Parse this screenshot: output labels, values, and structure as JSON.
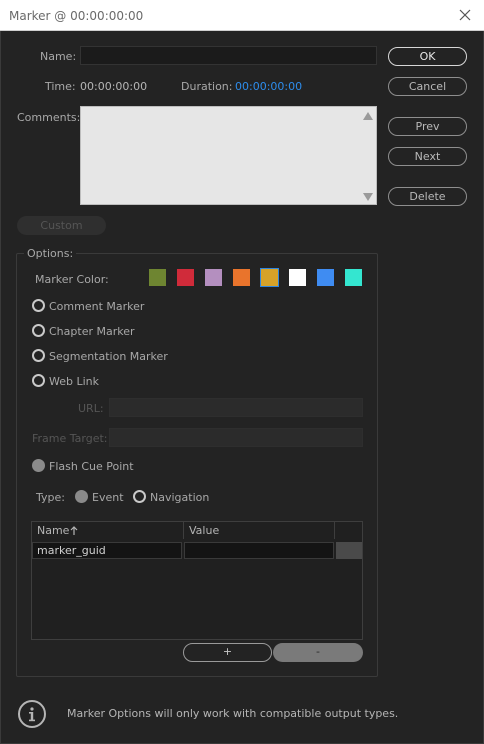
{
  "window": {
    "title": "Marker @ 00:00:00:00"
  },
  "fields": {
    "name_label": "Name:",
    "name_value": "",
    "time_label": "Time:",
    "time_value": "00:00:00:00",
    "duration_label": "Duration:",
    "duration_value": "00:00:00:00",
    "comments_label": "Comments:"
  },
  "buttons": {
    "ok": "OK",
    "cancel": "Cancel",
    "prev": "Prev",
    "next": "Next",
    "delete": "Delete",
    "custom": "Custom",
    "add": "+",
    "remove": "-"
  },
  "options": {
    "legend": "Options:",
    "marker_color_label": "Marker Color:",
    "colors": [
      "#6e8531",
      "#d02b3a",
      "#b48fbf",
      "#e9742c",
      "#d6a229",
      "#ffffff",
      "#3f8cf2",
      "#34e6d0"
    ],
    "selected_color_index": 4,
    "marker_types": [
      {
        "label": "Comment Marker",
        "checked": false
      },
      {
        "label": "Chapter Marker",
        "checked": false
      },
      {
        "label": "Segmentation Marker",
        "checked": false
      },
      {
        "label": "Web Link",
        "checked": false
      }
    ],
    "url_label": "URL:",
    "frame_target_label": "Frame Target:",
    "flash_cue_point_label": "Flash Cue Point",
    "type_label": "Type:",
    "type_event_label": "Event",
    "type_navigation_label": "Navigation"
  },
  "table": {
    "col_name": "Name",
    "col_value": "Value",
    "rows": [
      {
        "name": "marker_guid",
        "value": ""
      }
    ]
  },
  "info": {
    "text": "Marker Options will only work with compatible output types."
  }
}
